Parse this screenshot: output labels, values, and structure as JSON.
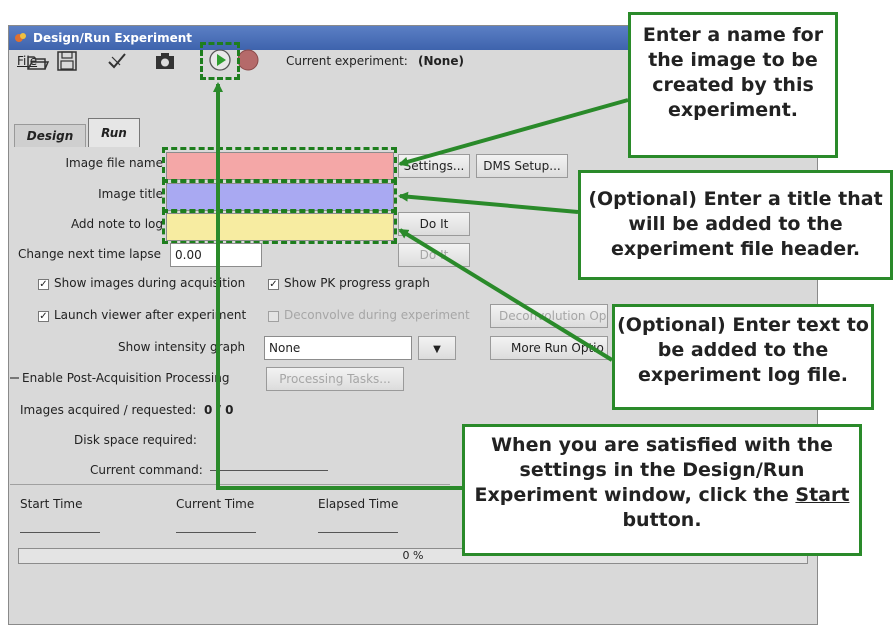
{
  "window": {
    "title": "Design/Run Experiment",
    "menu_file": "File"
  },
  "toolbar": {
    "current_experiment_label": "Current experiment:",
    "current_experiment_value": "(None)"
  },
  "tabs": {
    "design": "Design",
    "run": "Run"
  },
  "form": {
    "image_file_name_label": "Image file name",
    "image_title_label": "Image title",
    "add_note_label": "Add note to log",
    "time_lapse_label": "Change next time lapse",
    "time_lapse_value": "0.00",
    "settings_button": "Settings...",
    "dms_setup_button": "DMS Setup...",
    "do_it_button": "Do It",
    "do_it_button_2": "Do It"
  },
  "options": {
    "show_images": "Show images during acquisition",
    "show_pk": "Show PK progress graph",
    "launch_viewer": "Launch viewer after experiment",
    "deconvolve": "Deconvolve during experiment",
    "deconvolution_options": "Deconvolution Op",
    "show_intensity_graph": "Show intensity graph",
    "intensity_select_value": "None",
    "more_run_options": "More Run Optio",
    "enable_post": "Enable Post-Acquisition Processing",
    "processing_tasks": "Processing Tasks..."
  },
  "status": {
    "images_label": "Images acquired / requested:",
    "images_value": "0 / 0",
    "disk_label": "Disk space required:",
    "command_label": "Current command:",
    "start_time": "Start Time",
    "current_time": "Current Time",
    "elapsed_time": "Elapsed Time",
    "progress_text": "0 %"
  },
  "callouts": {
    "name": "Enter a name for the image to be created by this experiment.",
    "title": "(Optional) Enter a title that will be added to the experiment file header.",
    "log": "(Optional) Enter text to be added to the experiment log file.",
    "start_pre": "When you are satisfied with the settings in the Design/Run Experiment window, click the",
    "start_word": "Start",
    "start_post": "button."
  },
  "colors": {
    "image_file_name_highlight": "#f4a7a7",
    "image_title_highlight": "#a9a9f2",
    "add_note_highlight": "#f7eca1",
    "callout_border": "#2a8a2a",
    "start_button": "#2e9e2e"
  },
  "icons": [
    "app-icon",
    "open-folder-icon",
    "save-icon",
    "checkmark-icon",
    "camera-icon",
    "start-play-icon",
    "stop-record-icon"
  ]
}
